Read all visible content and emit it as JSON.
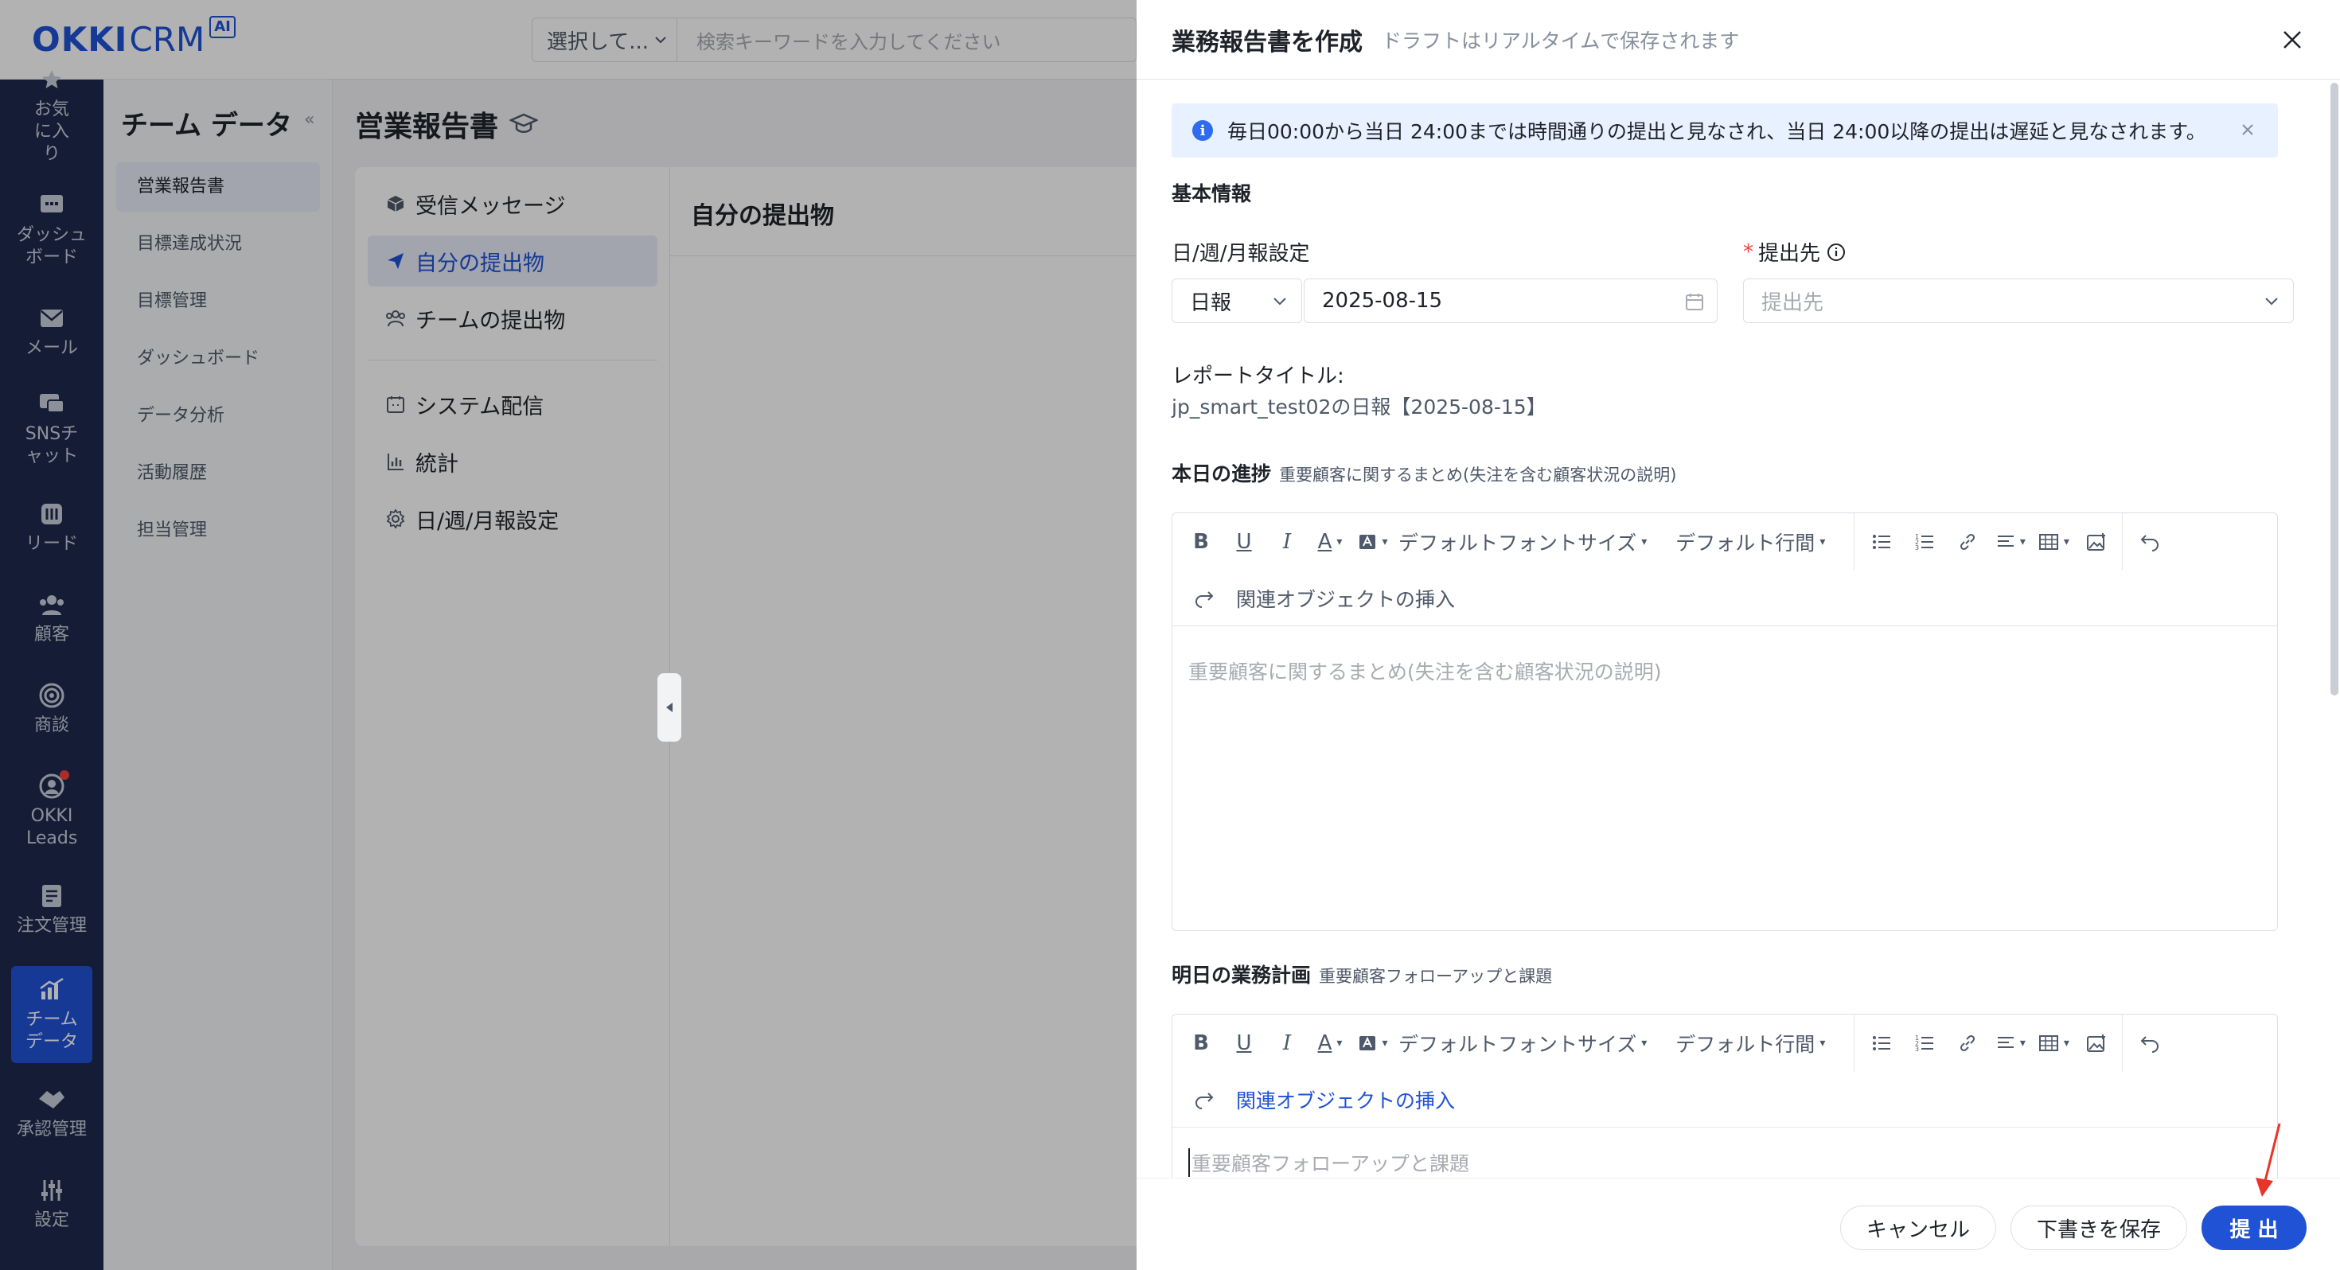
{
  "topbar": {
    "logo_main": "OKKI",
    "logo_crm": "CRM",
    "logo_ai": "AI",
    "search_select": "選択して...",
    "search_placeholder": "検索キーワードを入力してください"
  },
  "leftnav": {
    "items": [
      {
        "label": "お気に入り",
        "icon": "star-icon"
      },
      {
        "label": "ダッシュボード",
        "icon": "dashboard-icon"
      },
      {
        "label": "メール",
        "icon": "mail-icon"
      },
      {
        "label": "SNSチャット",
        "icon": "chat-icon"
      },
      {
        "label": "リード",
        "icon": "lead-icon"
      },
      {
        "label": "顧客",
        "icon": "customer-icon"
      },
      {
        "label": "商談",
        "icon": "target-icon"
      },
      {
        "label": "OKKI Leads",
        "icon": "okki-leads-icon"
      },
      {
        "label": "注文管理",
        "icon": "order-icon"
      },
      {
        "label": "チームデータ",
        "icon": "team-data-icon"
      },
      {
        "label": "承認管理",
        "icon": "approval-icon"
      },
      {
        "label": "設定",
        "icon": "settings-icon"
      }
    ]
  },
  "sidebar2": {
    "title": "チーム データ",
    "collapse": "«",
    "items": [
      "営業報告書",
      "目標達成状況",
      "目標管理",
      "ダッシュボード",
      "データ分析",
      "活動履歴",
      "担当管理"
    ]
  },
  "main": {
    "title": "営業報告書",
    "nav": [
      "受信メッセージ",
      "自分の提出物",
      "チームの提出物",
      "システム配信",
      "統計",
      "日/週/月報設定"
    ],
    "content_title": "自分の提出物"
  },
  "drawer": {
    "title": "業務報告書を作成",
    "subtitle": "ドラフトはリアルタイムで保存されます",
    "alert": "毎日00:00から当日 24:00までは時間通りの提出と見なされ、当日 24:00以降の提出は遅延と見なされます。",
    "basic_info": "基本情報",
    "period_label": "日/週/月報設定",
    "period_value": "日報",
    "date_value": "2025-08-15",
    "recipient_label": "提出先",
    "recipient_placeholder": "提出先",
    "report_title_label": "レポートタイトル:",
    "report_title_value": "jp_smart_test02の日報【2025-08-15】",
    "today_title": "本日の進捗",
    "today_desc": "重要顧客に関するまとめ(失注を含む顧客状況の説明)",
    "today_placeholder": "重要顧客に関するまとめ(失注を含む顧客状況の説明)",
    "tomorrow_title": "明日の業務計画",
    "tomorrow_desc": "重要顧客フォローアップと課題",
    "tomorrow_placeholder": "重要顧客フォローアップと課題",
    "toolbar": {
      "font_size": "デフォルトフォントサイズ",
      "line_height": "デフォルト行間",
      "insert_object": "関連オブジェクトの挿入"
    },
    "footer": {
      "cancel": "キャンセル",
      "save_draft": "下書きを保存",
      "submit": "提 出"
    }
  },
  "colors": {
    "brand": "#2052d6",
    "nav_bg": "#1d2a4d",
    "alert_bg": "#e8f1ff",
    "required": "#f53f3f"
  }
}
